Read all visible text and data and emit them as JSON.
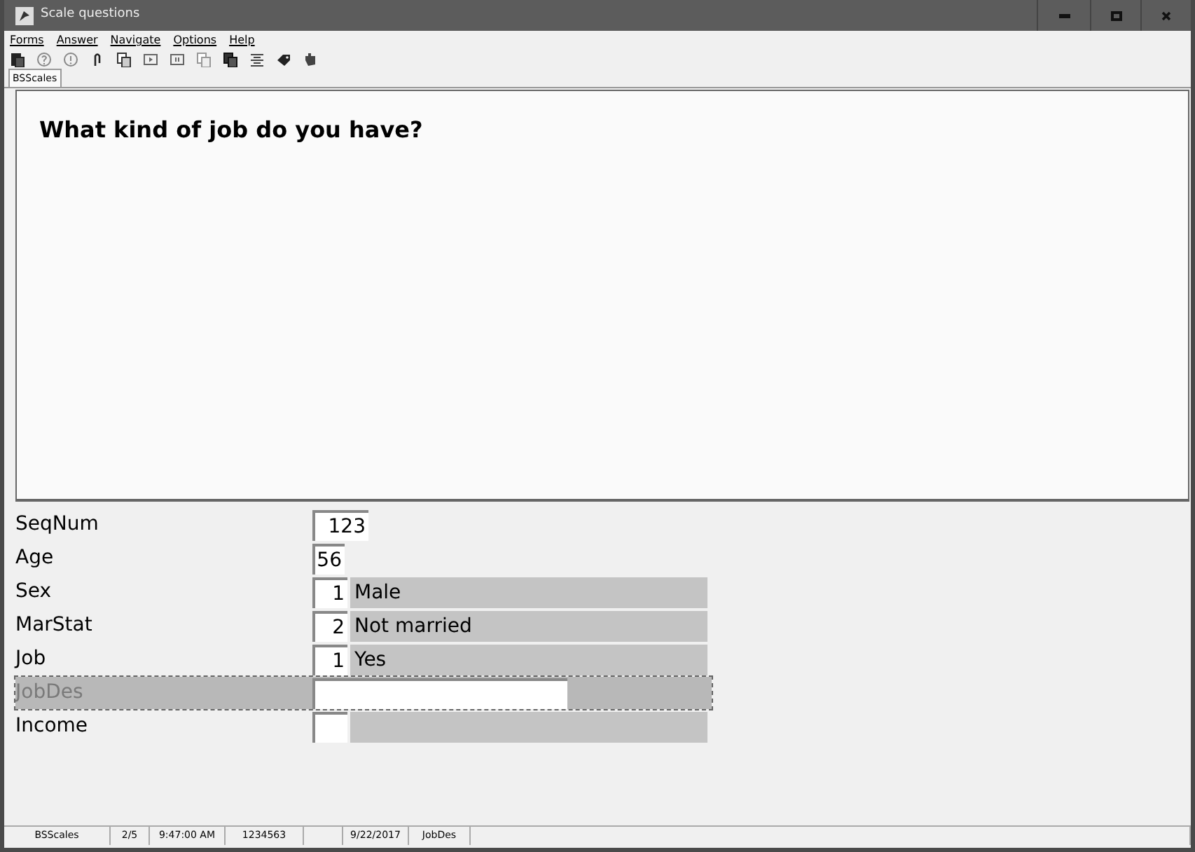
{
  "window": {
    "title": "Scale questions"
  },
  "menu": [
    "Forms",
    "Answer",
    "Navigate",
    "Options",
    "Help"
  ],
  "toolbar": [
    {
      "kind": "document"
    },
    {
      "kind": "question"
    },
    {
      "kind": "exclamation"
    },
    {
      "kind": "paperclip"
    },
    {
      "kind": "copy"
    },
    {
      "kind": "play"
    },
    {
      "kind": "pause"
    },
    {
      "kind": "pages"
    },
    {
      "kind": "copy-dark"
    },
    {
      "kind": "list"
    },
    {
      "kind": "tag"
    },
    {
      "kind": "hand"
    }
  ],
  "tabs": [
    {
      "label": "BSScales",
      "selected": true
    }
  ],
  "question": "What kind of job do you have?",
  "fields": [
    {
      "label": "SeqNum",
      "kind": "number",
      "value": "123",
      "selected": false
    },
    {
      "label": "Age",
      "kind": "number",
      "value": "56",
      "selected": false
    },
    {
      "label": "Sex",
      "kind": "coded",
      "value": "1",
      "description": "Male",
      "selected": false
    },
    {
      "label": "MarStat",
      "kind": "coded",
      "value": "2",
      "description": "Not married",
      "selected": false
    },
    {
      "label": "Job",
      "kind": "coded",
      "value": "1",
      "description": "Yes",
      "selected": false
    },
    {
      "label": "JobDes",
      "kind": "text",
      "selected": true
    },
    {
      "label": "Income",
      "kind": "coded",
      "selected": false
    }
  ],
  "status_bar": [
    {
      "kind": "text",
      "text": "BSScales"
    },
    {
      "kind": "text",
      "text": "2/5"
    },
    {
      "kind": "text",
      "text": "9:47:00 AM"
    },
    {
      "kind": "text",
      "text": "1234563"
    },
    {
      "kind": "blank"
    },
    {
      "kind": "text",
      "text": "9/22/2017"
    },
    {
      "kind": "text",
      "text": "JobDes"
    },
    {
      "kind": "blank"
    }
  ]
}
